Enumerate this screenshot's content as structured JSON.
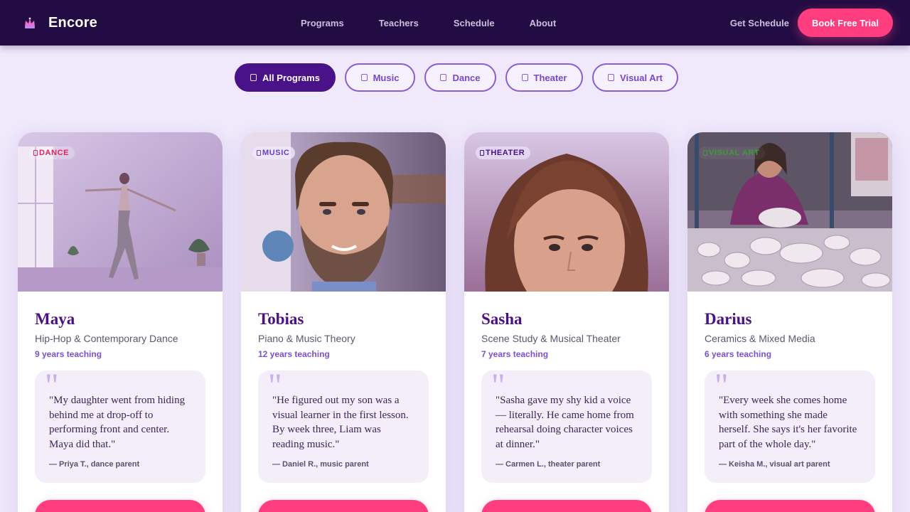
{
  "header": {
    "brand": "Encore",
    "nav": [
      "Programs",
      "Teachers",
      "Schedule",
      "About"
    ],
    "get_schedule": "Get Schedule",
    "book_trial": "Book Free Trial"
  },
  "filters": [
    {
      "label": "All Programs",
      "active": true
    },
    {
      "label": "Music",
      "active": false
    },
    {
      "label": "Dance",
      "active": false
    },
    {
      "label": "Theater",
      "active": false
    },
    {
      "label": "Visual Art",
      "active": false
    }
  ],
  "teachers": [
    {
      "badge": "DANCE",
      "badge_color": "#e0245e",
      "name": "Maya",
      "subject": "Hip-Hop & Contemporary Dance",
      "years": "9 years teaching",
      "quote": "\"My daughter went from hiding behind me at drop-off to performing front and center. Maya did that.\"",
      "author": "— Priya T., dance parent"
    },
    {
      "badge": "MUSIC",
      "badge_color": "#6a3fc7",
      "name": "Tobias",
      "subject": "Piano & Music Theory",
      "years": "12 years teaching",
      "quote": "\"He figured out my son was a visual learner in the first lesson. By week three, Liam was reading music.\"",
      "author": "— Daniel R., music parent"
    },
    {
      "badge": "THEATER",
      "badge_color": "#4a1289",
      "name": "Sasha",
      "subject": "Scene Study & Musical Theater",
      "years": "7 years teaching",
      "quote": "\"Sasha gave my shy kid a voice — literally. He came home from rehearsal doing character voices at dinner.\"",
      "author": "— Carmen L., theater parent"
    },
    {
      "badge": "VISUAL ART",
      "badge_color": "#3f9a3a",
      "name": "Darius",
      "subject": "Ceramics & Mixed Media",
      "years": "6 years teaching",
      "quote": "\"Every week she comes home with something she made herself. She says it's her favorite part of the whole day.\"",
      "author": "— Keisha M., visual art parent"
    }
  ],
  "quote_mark": "\"",
  "icons": {
    "brand": "crown-icon",
    "filter": "tag-icon",
    "badge": "tag-icon"
  }
}
